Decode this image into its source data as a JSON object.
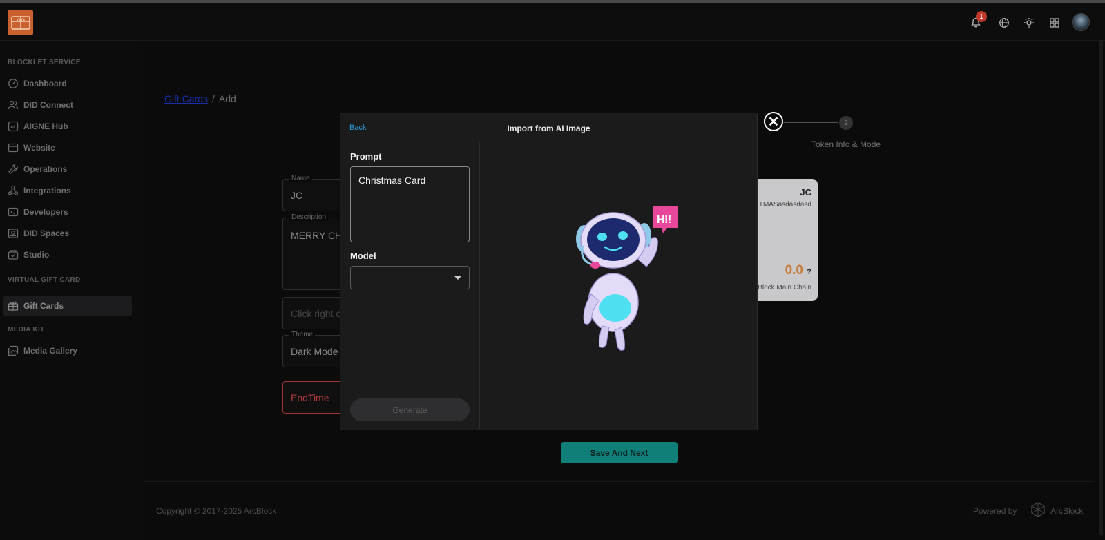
{
  "header": {
    "notification_count": "1",
    "icons": [
      "bell-icon",
      "globe-icon",
      "sun-icon",
      "apps-icon",
      "avatar"
    ]
  },
  "sidebar": {
    "sections": [
      {
        "title": "BLOCKLET SERVICE",
        "items": [
          {
            "label": "Dashboard",
            "icon": "gauge-icon"
          },
          {
            "label": "DID Connect",
            "icon": "users-icon"
          },
          {
            "label": "AIGNE Hub",
            "icon": "ai-icon"
          },
          {
            "label": "Website",
            "icon": "browser-icon"
          },
          {
            "label": "Operations",
            "icon": "wrench-icon"
          },
          {
            "label": "Integrations",
            "icon": "integrations-icon"
          },
          {
            "label": "Developers",
            "icon": "terminal-icon"
          },
          {
            "label": "DID Spaces",
            "icon": "drive-icon"
          },
          {
            "label": "Studio",
            "icon": "studio-icon"
          }
        ]
      },
      {
        "title": "VIRTUAL GIFT CARD",
        "items": [
          {
            "label": "Gift Cards",
            "icon": "gift-icon",
            "active": true
          }
        ]
      },
      {
        "title": "MEDIA KIT",
        "items": [
          {
            "label": "Media Gallery",
            "icon": "gallery-icon"
          }
        ]
      }
    ]
  },
  "breadcrumb": {
    "link": "Gift Cards",
    "separator": "/",
    "current": "Add"
  },
  "stepper": {
    "step2_number": "2",
    "step2_label": "Token Info & Mode"
  },
  "form": {
    "name_legend": "Name",
    "name_value": "JC",
    "description_legend": "Description",
    "description_value": "MERRY CHR",
    "image_placeholder": "Click right o",
    "theme_legend": "Theme",
    "theme_value": "Dark Mode",
    "endtime_placeholder": "EndTime"
  },
  "preview_card": {
    "name": "JC",
    "address": "TMASasdasdasd",
    "amount": "0.0",
    "amount_suffix": "?",
    "chain": "Block Main Chain"
  },
  "save_button": "Save And Next",
  "modal": {
    "back": "Back",
    "title": "Import from AI Image",
    "prompt_label": "Prompt",
    "prompt_value": "Christmas Card",
    "model_label": "Model",
    "model_value": "",
    "generate_label": "Generate",
    "image_bubble_text": "HI!"
  },
  "footer": {
    "copyright": "Copyright © 2017-2025  ArcBlock",
    "powered_by": "Powered by",
    "brand": "ArcBlock"
  },
  "colors": {
    "accent_teal": "#0f7f78",
    "logo_orange": "#c8612e",
    "link_blue": "#2e9bdc",
    "error_red": "#a13535"
  }
}
